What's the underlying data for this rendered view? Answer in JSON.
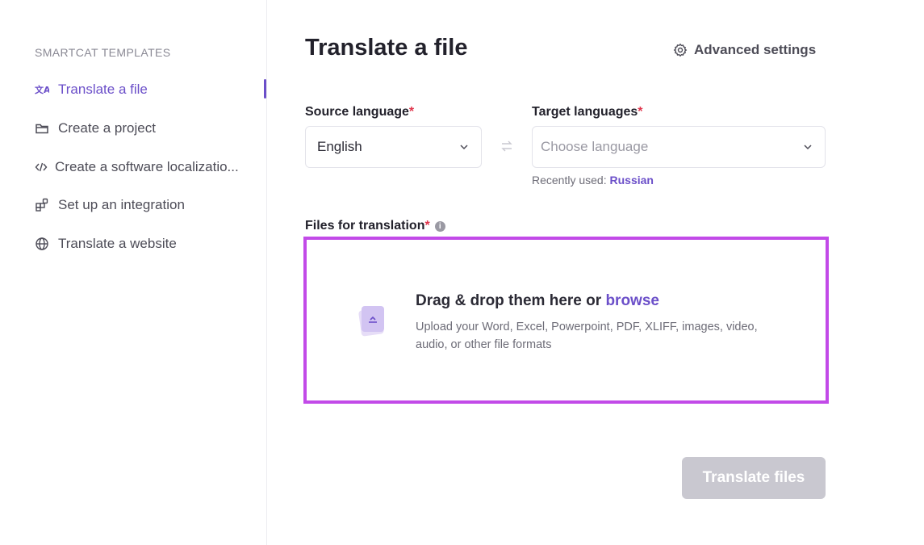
{
  "sidebar": {
    "heading": "SMARTCAT TEMPLATES",
    "items": [
      {
        "label": "Translate a file",
        "icon": "translate-icon",
        "active": true
      },
      {
        "label": "Create a project",
        "icon": "folder-icon",
        "active": false
      },
      {
        "label": "Create a software localizatio...",
        "icon": "code-icon",
        "active": false
      },
      {
        "label": "Set up an integration",
        "icon": "integration-icon",
        "active": false
      },
      {
        "label": "Translate a website",
        "icon": "globe-icon",
        "active": false
      }
    ]
  },
  "main": {
    "title": "Translate a file",
    "advanced_settings": "Advanced settings",
    "source": {
      "label": "Source language",
      "required_mark": "*",
      "value": "English"
    },
    "target": {
      "label": "Target languages",
      "required_mark": "*",
      "placeholder": "Choose language",
      "recent_prefix": "Recently used:",
      "recent_value": "Russian"
    },
    "files": {
      "label": "Files for translation",
      "required_mark": "*",
      "info_glyph": "i",
      "drop_text": "Drag & drop them here or",
      "browse_text": "browse",
      "description": "Upload your Word, Excel, Powerpoint, PDF, XLIFF, images, video, audio, or other file formats"
    },
    "submit_label": "Translate files"
  },
  "colors": {
    "accent": "#6b4fc9",
    "required": "#e0344b",
    "dropzone_border": "#c24ae8",
    "disabled_button": "#c9c8d0"
  }
}
